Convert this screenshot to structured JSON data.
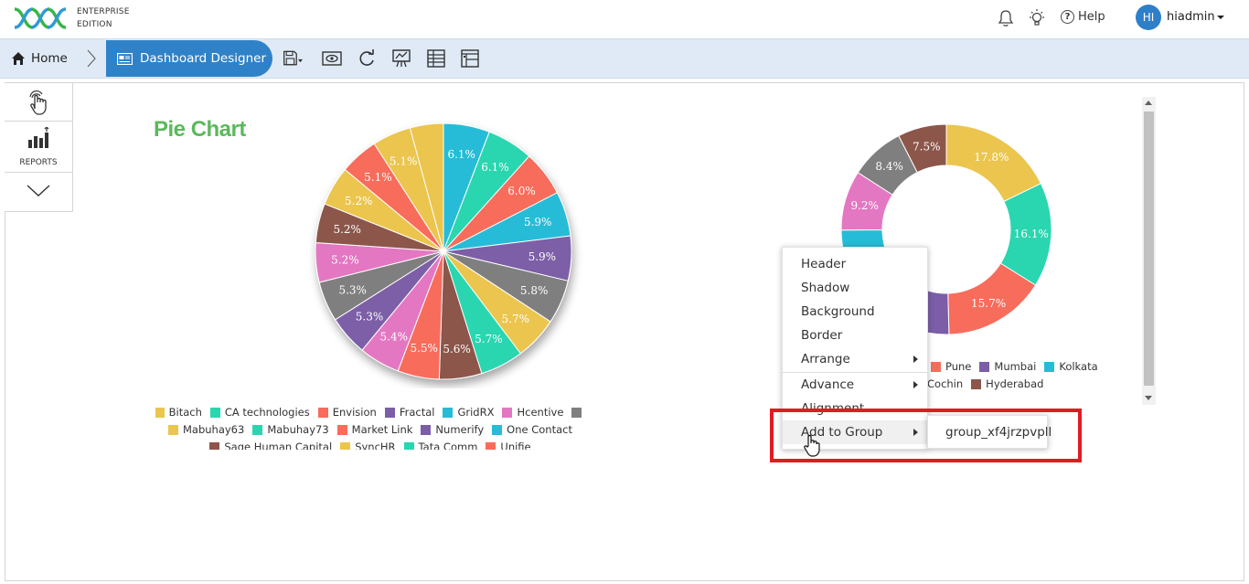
{
  "header": {
    "edition_line1": "ENTERPRISE",
    "edition_line2": "EDITION",
    "help_label": "Help",
    "avatar_initials": "HI",
    "username": "hiadmin"
  },
  "navbar": {
    "home_label": "Home",
    "designer_label": "Dashboard Designer"
  },
  "side_panel": {
    "reports_label": "REPORTS"
  },
  "pie_chart_title": "Pie Chart",
  "chart_data": [
    {
      "type": "pie",
      "title": "Pie Chart",
      "categories": [
        "GridRX",
        "CA technologies",
        "Envision",
        "GridRX",
        "Fractal",
        "Hcentive",
        "Mabuhay63",
        "Mabuhay73",
        "Market Link",
        "Numerify",
        "Hcentive",
        "Fractal",
        "Sage Human Capital",
        "Bitach",
        "Hcentive",
        "Sage Human Capital",
        "Bitach",
        "Market Link",
        "Bitach"
      ],
      "labels": [
        "6.1%",
        "6.1%",
        "6.0%",
        "5.9%",
        "5.9%",
        "5.8%",
        "5.7%",
        "5.7%",
        "5.6%",
        "5.5%",
        "5.4%",
        "5.3%",
        "5.3%",
        "5.2%",
        "5.2%",
        "5.2%",
        "5.1%",
        "5.1%",
        ""
      ],
      "values": [
        6.1,
        6.1,
        6.0,
        5.9,
        5.9,
        5.8,
        5.7,
        5.7,
        5.6,
        5.5,
        5.4,
        5.3,
        5.3,
        5.2,
        5.2,
        5.2,
        5.1,
        5.1,
        4.4
      ],
      "colors": [
        "#26bcd7",
        "#29d6b0",
        "#f86c5c",
        "#26bcd7",
        "#7b5ea7",
        "#7f7f7f",
        "#ebc54e",
        "#29d6b0",
        "#8c564b",
        "#f86c5c",
        "#e377c2",
        "#7b5ea7",
        "#7f7f7f",
        "#e377c2",
        "#8c564b",
        "#ebc54e",
        "#f86c5c",
        "#ebc54e",
        "#ebc54e"
      ],
      "legend": [
        "Bitach",
        "CA technologies",
        "Envision",
        "Fractal",
        "GridRX",
        "Hcentive",
        "",
        "Mabuhay63",
        "Mabuhay73",
        "Market Link",
        "Numerify",
        "One Contact",
        "Sage Human Capital",
        "SyncHR",
        "Tata Comm",
        "Unifie"
      ],
      "legend_colors": [
        "#ebc54e",
        "#29d6b0",
        "#f86c5c",
        "#7b5ea7",
        "#26bcd7",
        "#e377c2",
        "#7f7f7f",
        "#ebc54e",
        "#29d6b0",
        "#f86c5c",
        "#7b5ea7",
        "#26bcd7",
        "#8c564b",
        "#ebc54e",
        "#29d6b0",
        "#f86c5c"
      ]
    },
    {
      "type": "pie",
      "donut": true,
      "labels": [
        "17.8%",
        "16.1%",
        "15.7%",
        "",
        "",
        "9.2%",
        "8.4%",
        "7.5%"
      ],
      "values": [
        17.8,
        16.1,
        15.7,
        12.0,
        13.3,
        9.2,
        8.4,
        7.5
      ],
      "colors": [
        "#ebc54e",
        "#29d6b0",
        "#f86c5c",
        "#7b5ea7",
        "#26bcd7",
        "#e377c2",
        "#7f7f7f",
        "#8c564b"
      ],
      "legend": [
        "Pune",
        "Mumbai",
        "Kolkata",
        "Cochin",
        "Hyderabad"
      ],
      "legend_colors": [
        "#f86c5c",
        "#7b5ea7",
        "#26bcd7",
        "#e377c2",
        "#8c564b"
      ]
    }
  ],
  "context_menu": {
    "items": [
      "Header",
      "Shadow",
      "Background",
      "Border",
      "Arrange",
      "Advance",
      "Alignment",
      "Add to Group"
    ],
    "submenu_item": "group_xf4jrzpvpll"
  },
  "colors": {
    "accent": "#2f82c8",
    "navbar_bg": "#dfeaf6",
    "title_green": "#5cb85c",
    "highlight_red": "#e21b23"
  }
}
